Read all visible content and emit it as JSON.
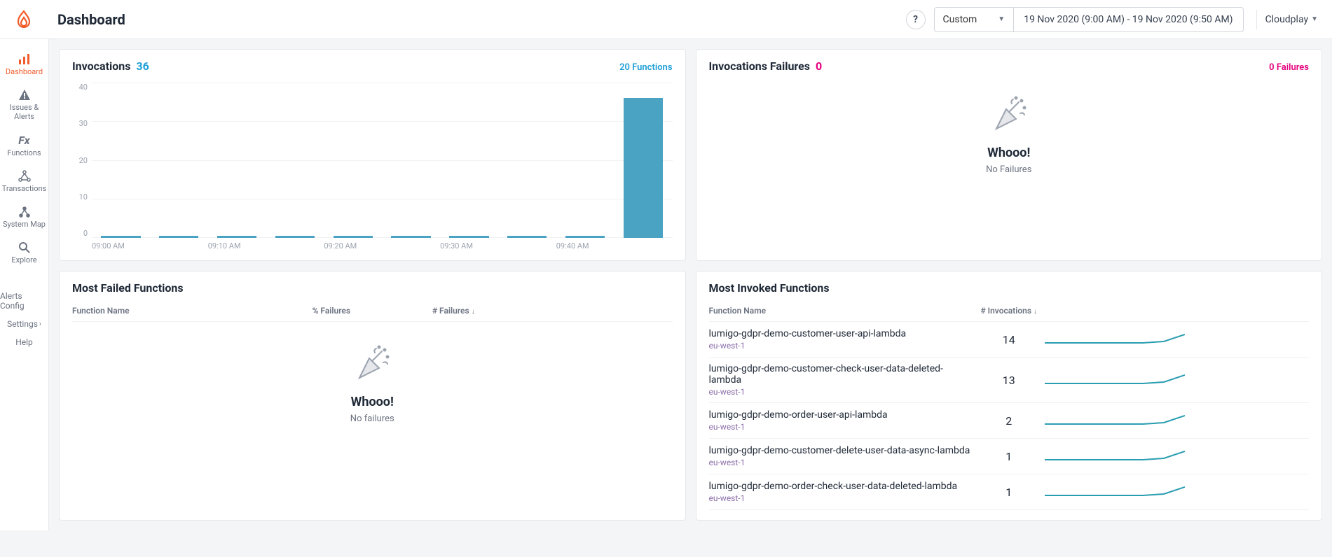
{
  "header": {
    "page_title": "Dashboard",
    "help_label": "?",
    "range_mode": "Custom",
    "range_text": "19 Nov 2020 (9:00 AM) - 19 Nov 2020 (9:50 AM)",
    "account": "Cloudplay"
  },
  "sidebar": {
    "items": [
      {
        "label": "Dashboard",
        "icon": "chart-bar-icon",
        "active": true
      },
      {
        "label": "Issues & Alerts",
        "icon": "warning-icon"
      },
      {
        "label": "Functions",
        "icon": "fx-icon"
      },
      {
        "label": "Transactions",
        "icon": "nodes-icon"
      },
      {
        "label": "System Map",
        "icon": "map-icon"
      },
      {
        "label": "Explore",
        "icon": "search-icon"
      }
    ],
    "links": [
      {
        "label": "Alerts Config"
      },
      {
        "label": "Settings",
        "chev": true
      },
      {
        "label": "Help"
      }
    ]
  },
  "invocations_card": {
    "title": "Invocations",
    "count": "36",
    "link": "20 Functions"
  },
  "failures_card": {
    "title": "Invocations Failures",
    "count": "0",
    "link": "0 Failures",
    "empty_title": "Whooo!",
    "empty_sub": "No Failures"
  },
  "most_failed_card": {
    "title": "Most Failed Functions",
    "col_name": "Function Name",
    "col_pct": "% Failures",
    "col_num": "# Failures",
    "empty_title": "Whooo!",
    "empty_sub": "No failures"
  },
  "most_invoked_card": {
    "title": "Most Invoked Functions",
    "col_name": "Function Name",
    "col_inv": "# Invocations",
    "rows": [
      {
        "name": "lumigo-gdpr-demo-customer-user-api-lambda",
        "region": "eu-west-1",
        "count": "14"
      },
      {
        "name": "lumigo-gdpr-demo-customer-check-user-data-deleted-lambda",
        "region": "eu-west-1",
        "count": "13"
      },
      {
        "name": "lumigo-gdpr-demo-order-user-api-lambda",
        "region": "eu-west-1",
        "count": "2"
      },
      {
        "name": "lumigo-gdpr-demo-customer-delete-user-data-async-lambda",
        "region": "eu-west-1",
        "count": "1"
      },
      {
        "name": "lumigo-gdpr-demo-order-check-user-data-deleted-lambda",
        "region": "eu-west-1",
        "count": "1"
      }
    ]
  },
  "chart_data": {
    "type": "bar",
    "title": "Invocations",
    "ylabel": "",
    "ylim": [
      0,
      40
    ],
    "yticks": [
      0,
      10,
      20,
      30,
      40
    ],
    "categories": [
      "09:00 AM",
      "09:05 AM",
      "09:10 AM",
      "09:15 AM",
      "09:20 AM",
      "09:25 AM",
      "09:30 AM",
      "09:35 AM",
      "09:40 AM",
      "09:45 AM"
    ],
    "tick_labels_shown": [
      "09:00 AM",
      "",
      "09:10 AM",
      "",
      "09:20 AM",
      "",
      "09:30 AM",
      "",
      "09:40 AM",
      ""
    ],
    "values": [
      0,
      0,
      0,
      0,
      0,
      0,
      0,
      0,
      0,
      36
    ]
  }
}
